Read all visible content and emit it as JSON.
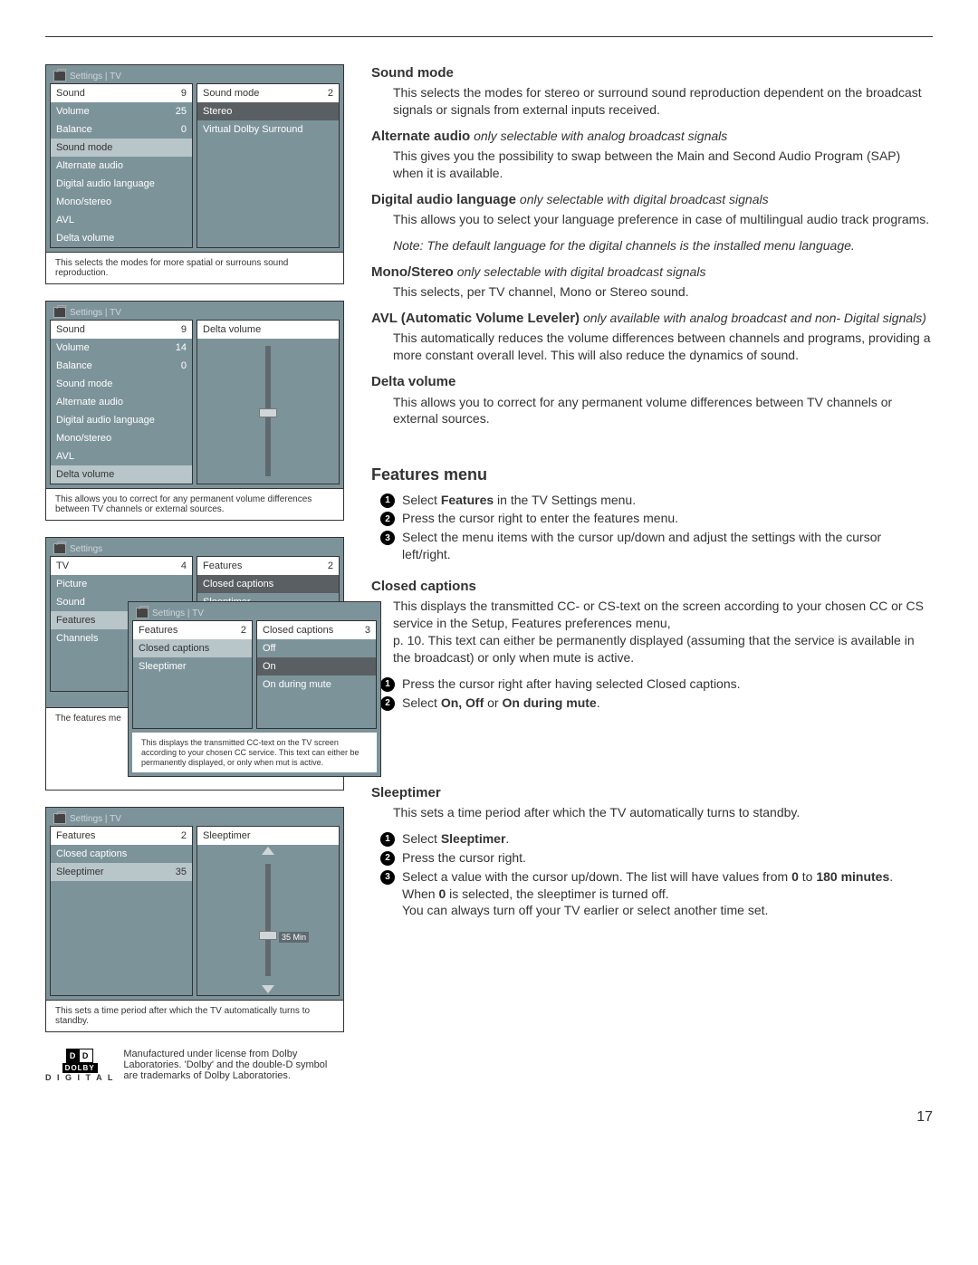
{
  "osd1": {
    "bc": "Settings | TV",
    "left": {
      "hdr_l": "Sound",
      "hdr_r": "9",
      "items": [
        {
          "l": "Volume",
          "r": "25"
        },
        {
          "l": "Balance",
          "r": "0"
        },
        {
          "l": "Sound mode",
          "r": "",
          "hl": true
        },
        {
          "l": "Alternate audio",
          "r": ""
        },
        {
          "l": "Digital audio language",
          "r": ""
        },
        {
          "l": "Mono/stereo",
          "r": ""
        },
        {
          "l": "AVL",
          "r": ""
        },
        {
          "l": "Delta volume",
          "r": ""
        }
      ]
    },
    "right": {
      "hdr_l": "Sound mode",
      "hdr_r": "2",
      "items": [
        {
          "l": "Stereo",
          "r": "",
          "sel": true
        },
        {
          "l": "Virtual Dolby Surround",
          "r": ""
        }
      ]
    },
    "caption": "This selects the modes for more spatial or surrouns sound reproduction."
  },
  "osd2": {
    "bc": "Settings | TV",
    "left": {
      "hdr_l": "Sound",
      "hdr_r": "9",
      "items": [
        {
          "l": "Volume",
          "r": "14"
        },
        {
          "l": "Balance",
          "r": "0"
        },
        {
          "l": "Sound mode",
          "r": ""
        },
        {
          "l": "Alternate audio",
          "r": ""
        },
        {
          "l": "Digital audio language",
          "r": ""
        },
        {
          "l": "Mono/stereo",
          "r": ""
        },
        {
          "l": "AVL",
          "r": ""
        },
        {
          "l": "Delta volume",
          "r": "",
          "hl": true
        }
      ]
    },
    "right_hdr": "Delta volume",
    "caption": "This allows you to correct for any permanent volume differences between TV channels or external sources."
  },
  "osd3": {
    "bc_outer": "Settings",
    "outer_left": {
      "hdr_l": "TV",
      "hdr_r": "4",
      "items": [
        {
          "l": "Picture",
          "r": ""
        },
        {
          "l": "Sound",
          "r": ""
        },
        {
          "l": "Features",
          "r": "",
          "hl": true
        },
        {
          "l": "Channels",
          "r": ""
        }
      ]
    },
    "outer_right": {
      "hdr_l": "Features",
      "hdr_r": "2",
      "items": [
        {
          "l": "Closed captions",
          "r": "",
          "sel": true
        },
        {
          "l": "Sleeptimer",
          "r": ""
        }
      ]
    },
    "outer_caption": "The features me",
    "bc_inner": "Settings | TV",
    "inner_left": {
      "hdr_l": "Features",
      "hdr_r": "2",
      "items": [
        {
          "l": "Closed captions",
          "r": "",
          "hl": true
        },
        {
          "l": "Sleeptimer",
          "r": ""
        }
      ]
    },
    "inner_right": {
      "hdr_l": "Closed captions",
      "hdr_r": "3",
      "items": [
        {
          "l": "Off",
          "r": ""
        },
        {
          "l": "On",
          "r": "",
          "sel": true
        },
        {
          "l": "On during mute",
          "r": ""
        }
      ]
    },
    "inner_caption": "This displays the transmitted CC-text on the TV screen according to your chosen CC service. This text can either be permanently displayed, or only when mut is active."
  },
  "osd4": {
    "bc": "Settings | TV",
    "left": {
      "hdr_l": "Features",
      "hdr_r": "2",
      "items": [
        {
          "l": "Closed captions",
          "r": ""
        },
        {
          "l": "Sleeptimer",
          "r": "35",
          "hl": true
        }
      ]
    },
    "right_hdr": "Sleeptimer",
    "slider_tag": "35 Min",
    "caption": "This sets a time period after which the TV automatically turns to standby."
  },
  "dolby": {
    "brand": "DOLBY",
    "sub": "D I G I T A L",
    "text": "Manufactured under license from Dolby Laboratories. 'Dolby' and the double-D symbol are trademarks of Dolby Laboratories."
  },
  "sections": {
    "sound_mode_h": "Sound mode",
    "sound_mode_p": "This selects the modes for stereo or surround sound reproduction dependent on the broadcast signals or signals from external inputs received.",
    "alt_audio_h": "Alternate audio",
    "alt_audio_s": "only selectable with analog broadcast signals",
    "alt_audio_p": "This gives you the possibility to swap between the Main and Second Audio Program (SAP) when it is available.",
    "dal_h": "Digital audio language",
    "dal_s": "only selectable with digital broadcast signals",
    "dal_p": "This allows you to select your language preference in case of multilingual audio track programs.",
    "dal_note": "Note: The default language for the digital channels is the installed menu language.",
    "ms_h": "Mono/Stereo",
    "ms_s": "only selectable with digital broadcast signals",
    "ms_p": "This selects, per TV channel, Mono or Stereo sound.",
    "avl_h": "AVL (Automatic Volume Leveler)",
    "avl_s": "only available with analog broadcast and non- Digital signals)",
    "avl_p": "This automatically reduces the volume differences between channels and programs, providing a more constant overall level.  This will also reduce the dynamics of sound.",
    "dv_h": "Delta volume",
    "dv_p": "This allows you to correct for any permanent volume differences between TV channels or external sources.",
    "features_h": "Features menu",
    "f1a": "Select ",
    "f1b": "Features",
    "f1c": " in the TV Settings menu.",
    "f2": "Press the cursor right to enter the features menu.",
    "f3": "Select the menu items with the cursor up/down and adjust the settings with the cursor left/right.",
    "cc_h": "Closed captions",
    "cc_p1": "This displays the transmitted CC- or CS-text on the screen according to your chosen CC or CS service in the Setup, Features preferences menu,",
    "cc_p2": "p. 10. This text can either be permanently displayed (assuming that the service is available in the broadcast) or only when mute is active.",
    "cc_s1": "Press the cursor right after having selected Closed captions.",
    "cc_s2a": "Select ",
    "cc_s2b": "On, Off",
    "cc_s2c": " or ",
    "cc_s2d": "On during mute",
    "cc_s2e": ".",
    "st_h": "Sleeptimer",
    "st_p": "This sets a time period after which the TV automatically turns to standby.",
    "st_s1a": "Select ",
    "st_s1b": "Sleeptimer",
    "st_s1c": ".",
    "st_s2": "Press the cursor right.",
    "st_s3a": "Select a value with the cursor up/down. The list will have values from ",
    "st_s3b": "0",
    "st_s3c": " to ",
    "st_s3d": "180 minutes",
    "st_s3e": ".",
    "st_s3f": "When ",
    "st_s3g": "0",
    "st_s3h": " is selected, the sleeptimer is turned off.",
    "st_s3i": "You can always turn off your TV earlier or select another time set."
  },
  "pagenum": "17"
}
